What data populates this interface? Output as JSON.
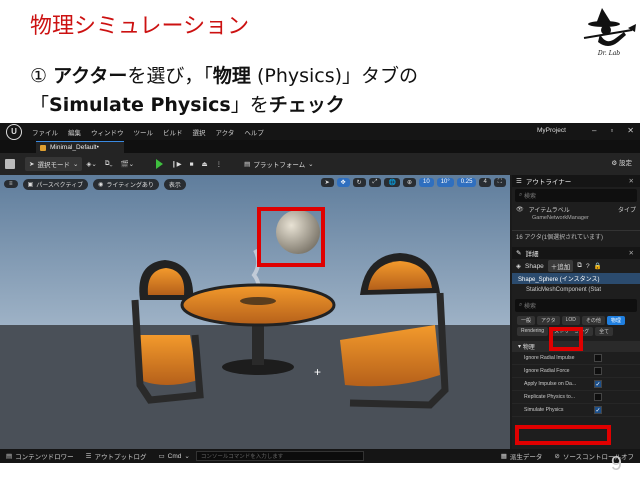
{
  "slide": {
    "title": "物理シミュレーション",
    "instruction_line1_pre": "① ",
    "instruction_line1_bold1": "アクター",
    "instruction_line1_mid": "を選び，「",
    "instruction_line1_bold2": "物理",
    "instruction_line1_paren": " (Physics)",
    "instruction_line1_end": "」タブの",
    "instruction_line2_pre": "「",
    "instruction_line2_bold1": "Simulate Physics",
    "instruction_line2_mid": "」を",
    "instruction_line2_bold2": "チェック",
    "page_number": "9",
    "logo_caption": "Dr. Lab"
  },
  "editor": {
    "menu": [
      "ファイル",
      "編集",
      "ウィンドウ",
      "ツール",
      "ビルド",
      "選択",
      "アクタ",
      "ヘルプ"
    ],
    "project_name": "MyProject",
    "level_tab": "Minimal_Default•",
    "toolbar": {
      "mode_label": "選択モード",
      "platform_label": "プラットフォーム",
      "settings_label": "設定"
    },
    "viewport": {
      "perspective_label": "パースペクティブ",
      "lighting_label": "ライティングあり",
      "show_label": "表示",
      "grid_value": "10",
      "angle_value": "10°",
      "scale_value": "0.25",
      "camera_speed": "4"
    },
    "outliner": {
      "title": "アウトライナー",
      "search_placeholder": "検索",
      "col_label": "アイテムラベル",
      "col_type": "タイプ",
      "row_text": "GameNetworkManager",
      "count_text": "16 アクタ(1個選択されています)"
    },
    "details": {
      "title": "詳細",
      "actor_name_short": "Shape",
      "add_label": "追加",
      "selected_component": "Shape_Sphere (インスタンス)",
      "sub_component": "StaticMeshComponent (Stat",
      "search_placeholder": "検索",
      "categories": [
        "一般",
        "アクタ",
        "LOD",
        "その他",
        "物理",
        "Rendering",
        "ストリーミング",
        "全て"
      ],
      "selected_category": "物理",
      "section_header": "物理",
      "properties": [
        {
          "label": "Ignore Radial Impulse",
          "checked": false
        },
        {
          "label": "Ignore Radial Force",
          "checked": false
        },
        {
          "label": "Apply Impulse on Da...",
          "checked": true
        },
        {
          "label": "Replicate Physics to...",
          "checked": false
        },
        {
          "label": "Simulate Physics",
          "checked": true
        }
      ]
    },
    "bottom_bar": {
      "content_drawer": "コンテンツドロワー",
      "output_log": "アウトプットログ",
      "cmd_label": "Cmd",
      "cmd_placeholder": "コンソールコマンドを入力します",
      "derived_data": "派生データ",
      "source_control": "ソースコントロールオフ"
    }
  }
}
